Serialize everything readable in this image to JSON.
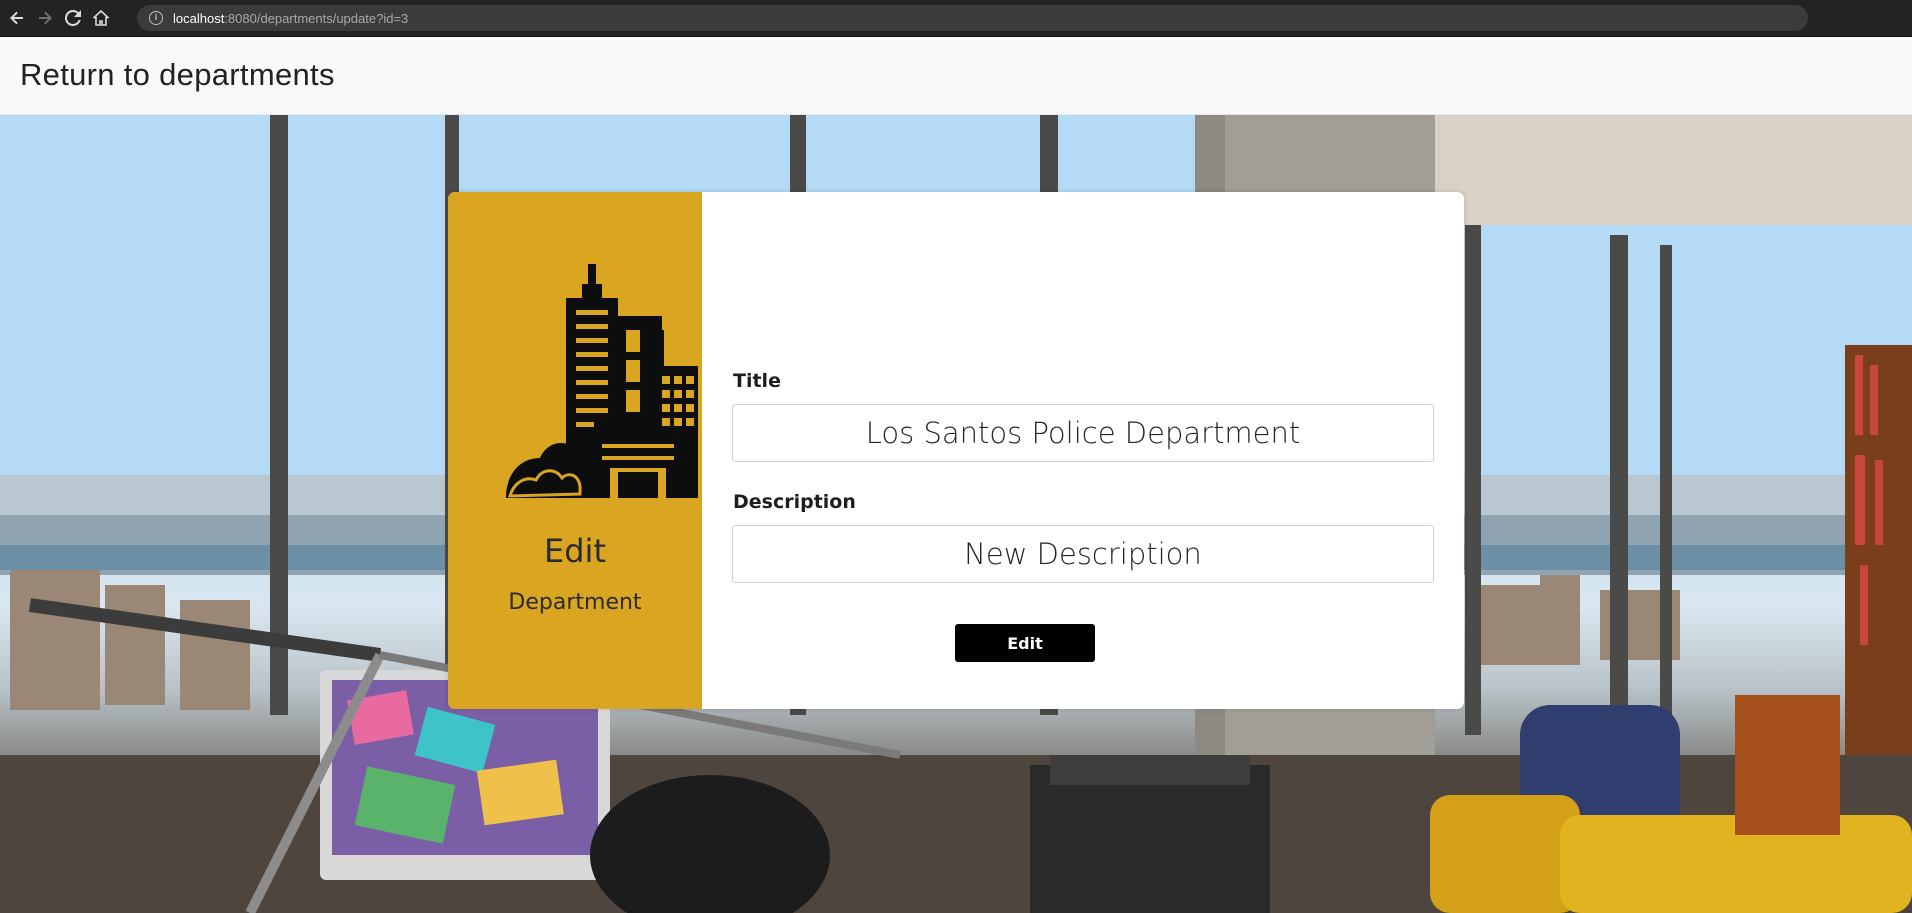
{
  "browser": {
    "url_host": "localhost",
    "url_rest": ":8080/departments/update?id=3",
    "icons": [
      "back-icon",
      "forward-icon",
      "reload-icon",
      "home-icon",
      "info-icon"
    ]
  },
  "nav": {
    "return_link": "Return to departments"
  },
  "card": {
    "heading": "Edit",
    "subheading": "Department",
    "accent_color": "#daa520",
    "form": {
      "title_label": "Title",
      "title_value": "Los Santos Police Department",
      "description_label": "Description",
      "description_value": "New Description",
      "submit_label": "Edit"
    }
  }
}
